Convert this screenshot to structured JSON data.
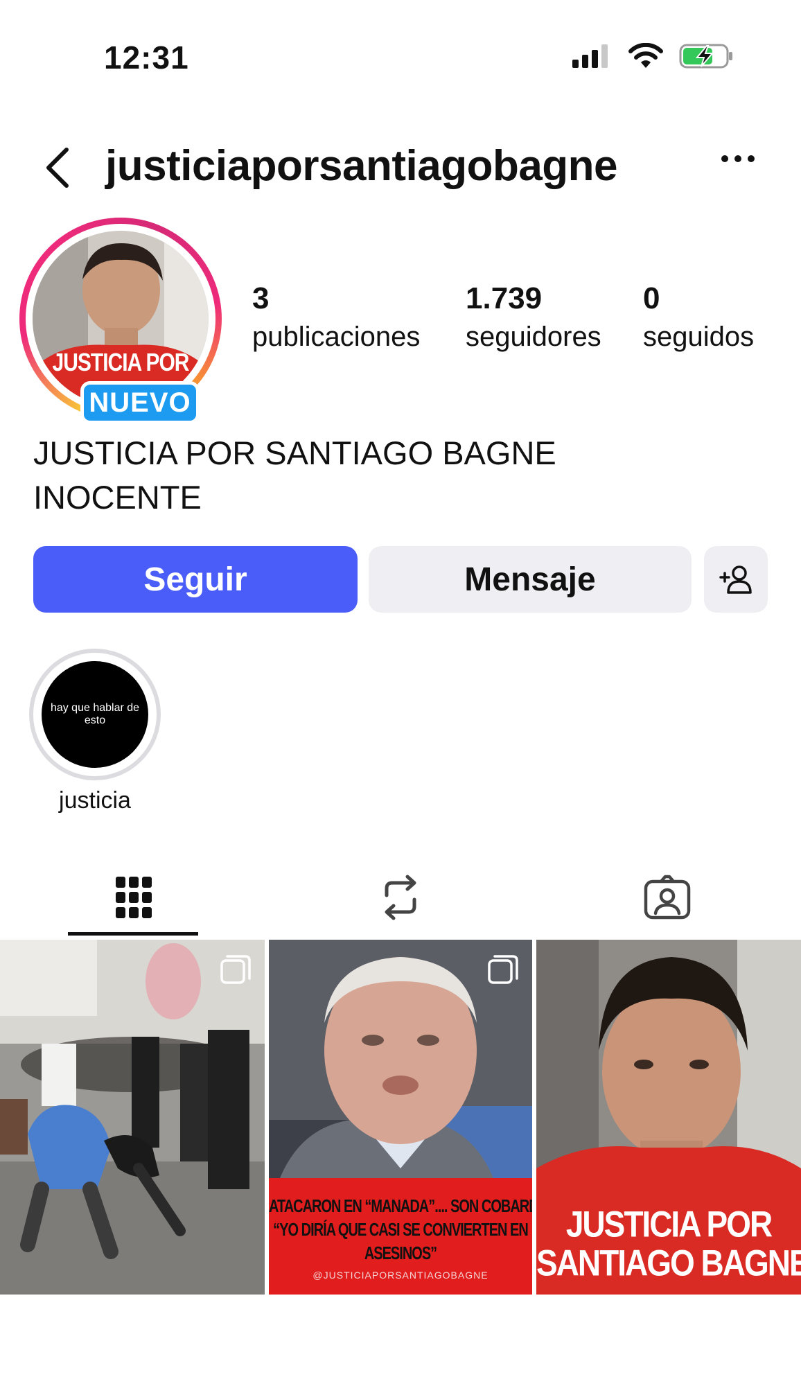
{
  "status_bar": {
    "time": "12:31"
  },
  "header": {
    "username": "justiciaporsantiagobagne"
  },
  "profile": {
    "avatar_text": "JUSTICIA POR",
    "new_badge": "NUEVO",
    "stats": [
      {
        "value": "3",
        "label": "publicaciones"
      },
      {
        "value": "1.739",
        "label": "seguidores"
      },
      {
        "value": "0",
        "label": "seguidos"
      }
    ],
    "bio_line1": "JUSTICIA POR SANTIAGO BAGNE",
    "bio_line2": "INOCENTE"
  },
  "buttons": {
    "follow": "Seguir",
    "message": "Mensaje"
  },
  "highlight": {
    "cover_text": "hay que hablar de esto",
    "label": "justicia"
  },
  "posts": [
    {
      "type": "video-street-scene"
    },
    {
      "caption_line1": "ATACARON EN “MANADA”.... SON COBARDES",
      "caption_line2": "“YO DIRÍA QUE CASI SE CONVIERTEN EN",
      "caption_line3": "ASESINOS”",
      "handle": "@JUSTICIAPORSANTIAGOBAGNE"
    },
    {
      "caption_line1": "JUSTICIA POR",
      "caption_line2": "SANTIAGO BAGNE"
    }
  ],
  "colors": {
    "follow_button": "#4a5df9",
    "secondary_button": "#efeff3",
    "badge": "#1d9bf0",
    "poster_red": "#e11d1d"
  }
}
